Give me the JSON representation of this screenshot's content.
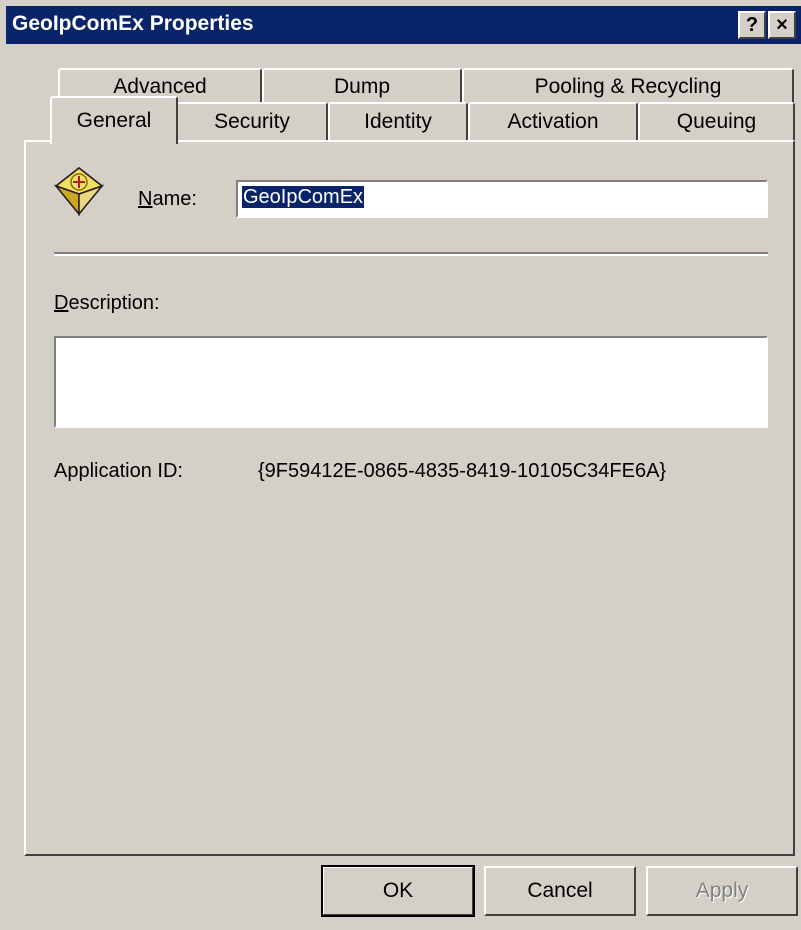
{
  "window": {
    "title": "GeoIpComEx Properties"
  },
  "titlebar_buttons": {
    "help": "?",
    "close": "×"
  },
  "tabs": {
    "back": [
      "Advanced",
      "Dump",
      "Pooling & Recycling"
    ],
    "front": [
      "General",
      "Security",
      "Identity",
      "Activation",
      "Queuing"
    ],
    "active": "General"
  },
  "general": {
    "icon": "com-component-package-icon",
    "name_label": "Name:",
    "name_value": "GeoIpComEx",
    "description_label": "Description:",
    "description_value": "",
    "app_id_label": "Application ID:",
    "app_id_value": "{9F59412E-0865-4835-8419-10105C34FE6A}"
  },
  "buttons": {
    "ok": "OK",
    "cancel": "Cancel",
    "apply": "Apply"
  },
  "colors": {
    "titlebar": "#0a246a",
    "face": "#d4d0c8",
    "selection": "#0a246a"
  }
}
